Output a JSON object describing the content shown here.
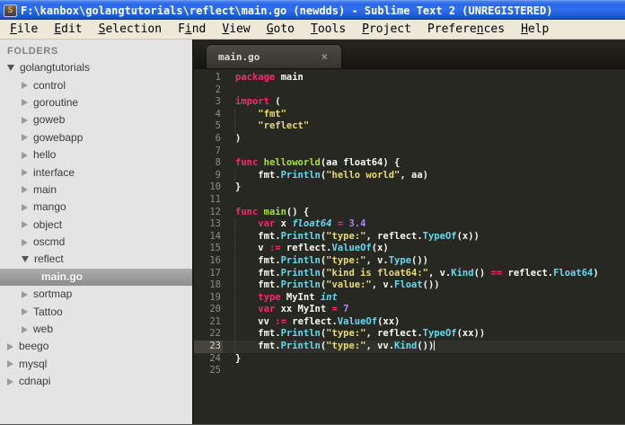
{
  "window": {
    "title": "F:\\kanbox\\golangtutorials\\reflect\\main.go (newdds) - Sublime Text 2 (UNREGISTERED)",
    "icon": "sublime-s-logo",
    "icon_glyph": "S"
  },
  "colors": {
    "titlebar_blue": "#2b67e8",
    "menubar_bg": "#ece9d8",
    "sidebar_bg": "#e4e4e4",
    "sidebar_selected": "#9a9a9a",
    "editor_bg": "#272822",
    "keyword_pink": "#f92672",
    "string_yellow": "#e6db74",
    "call_blue": "#66d9ef",
    "number_purple": "#ae81ff",
    "funcdef_green": "#a6e22e",
    "plain_text": "#f8f8f2",
    "gutter_text": "#8c8c84"
  },
  "menubar": {
    "items": [
      {
        "label": "File",
        "accel": 0
      },
      {
        "label": "Edit",
        "accel": 0
      },
      {
        "label": "Selection",
        "accel": 0
      },
      {
        "label": "Find",
        "accel": 1
      },
      {
        "label": "View",
        "accel": 0
      },
      {
        "label": "Goto",
        "accel": 0
      },
      {
        "label": "Tools",
        "accel": 0
      },
      {
        "label": "Project",
        "accel": 0
      },
      {
        "label": "Preferences",
        "accel": 7
      },
      {
        "label": "Help",
        "accel": 0
      }
    ]
  },
  "sidebar": {
    "header": "FOLDERS",
    "items": [
      {
        "label": "golangtutorials",
        "level": 1,
        "state": "expanded",
        "selected": false
      },
      {
        "label": "control",
        "level": 2,
        "state": "collapsed",
        "selected": false
      },
      {
        "label": "goroutine",
        "level": 2,
        "state": "collapsed",
        "selected": false
      },
      {
        "label": "goweb",
        "level": 2,
        "state": "collapsed",
        "selected": false
      },
      {
        "label": "gowebapp",
        "level": 2,
        "state": "collapsed",
        "selected": false
      },
      {
        "label": "hello",
        "level": 2,
        "state": "collapsed",
        "selected": false
      },
      {
        "label": "interface",
        "level": 2,
        "state": "collapsed",
        "selected": false
      },
      {
        "label": "main",
        "level": 2,
        "state": "collapsed",
        "selected": false
      },
      {
        "label": "mango",
        "level": 2,
        "state": "collapsed",
        "selected": false
      },
      {
        "label": "object",
        "level": 2,
        "state": "collapsed",
        "selected": false
      },
      {
        "label": "oscmd",
        "level": 2,
        "state": "collapsed",
        "selected": false
      },
      {
        "label": "reflect",
        "level": 2,
        "state": "expanded",
        "selected": false
      },
      {
        "label": "main.go",
        "level": 3,
        "state": "file",
        "selected": true
      },
      {
        "label": "sortmap",
        "level": 2,
        "state": "collapsed",
        "selected": false
      },
      {
        "label": "Tattoo",
        "level": 2,
        "state": "collapsed",
        "selected": false
      },
      {
        "label": "web",
        "level": 2,
        "state": "collapsed",
        "selected": false
      },
      {
        "label": "beego",
        "level": 1,
        "state": "collapsed",
        "selected": false
      },
      {
        "label": "mysql",
        "level": 1,
        "state": "collapsed",
        "selected": false
      },
      {
        "label": "cdnapi",
        "level": 1,
        "state": "collapsed",
        "selected": false
      }
    ]
  },
  "editor": {
    "tab": {
      "label": "main.go",
      "close": "×"
    },
    "lines": [
      {
        "n": 1,
        "seg": [
          [
            "k",
            "package"
          ],
          [
            "w",
            " main"
          ]
        ]
      },
      {
        "n": 2,
        "seg": []
      },
      {
        "n": 3,
        "seg": [
          [
            "k",
            "import"
          ],
          [
            "w",
            " ("
          ]
        ]
      },
      {
        "n": 4,
        "ind": true,
        "seg": [
          [
            "w",
            "    "
          ],
          [
            "s",
            "\"fmt\""
          ]
        ]
      },
      {
        "n": 5,
        "ind": true,
        "seg": [
          [
            "w",
            "    "
          ],
          [
            "s",
            "\"reflect\""
          ]
        ]
      },
      {
        "n": 6,
        "seg": [
          [
            "w",
            ")"
          ]
        ]
      },
      {
        "n": 7,
        "seg": []
      },
      {
        "n": 8,
        "seg": [
          [
            "k",
            "func"
          ],
          [
            "w",
            " "
          ],
          [
            "g",
            "helloworld"
          ],
          [
            "w",
            "(aa float64) {"
          ]
        ]
      },
      {
        "n": 9,
        "ind": true,
        "seg": [
          [
            "w",
            "    fmt."
          ],
          [
            "f",
            "Println"
          ],
          [
            "w",
            "("
          ],
          [
            "s",
            "\"hello world\""
          ],
          [
            "w",
            ", aa)"
          ]
        ]
      },
      {
        "n": 10,
        "seg": [
          [
            "w",
            "}"
          ]
        ]
      },
      {
        "n": 11,
        "seg": []
      },
      {
        "n": 12,
        "seg": [
          [
            "k",
            "func"
          ],
          [
            "w",
            " "
          ],
          [
            "g",
            "main"
          ],
          [
            "w",
            "() {"
          ]
        ]
      },
      {
        "n": 13,
        "ind": true,
        "seg": [
          [
            "w",
            "    "
          ],
          [
            "k",
            "var"
          ],
          [
            "w",
            " x "
          ],
          [
            "t",
            "float64"
          ],
          [
            "w",
            " "
          ],
          [
            "k",
            "="
          ],
          [
            "w",
            " "
          ],
          [
            "n2",
            "3.4"
          ]
        ]
      },
      {
        "n": 14,
        "ind": true,
        "seg": [
          [
            "w",
            "    fmt."
          ],
          [
            "f",
            "Println"
          ],
          [
            "w",
            "("
          ],
          [
            "s",
            "\"type:\""
          ],
          [
            "w",
            ", reflect."
          ],
          [
            "f",
            "TypeOf"
          ],
          [
            "w",
            "(x))"
          ]
        ]
      },
      {
        "n": 15,
        "ind": true,
        "seg": [
          [
            "w",
            "    v "
          ],
          [
            "k",
            ":="
          ],
          [
            "w",
            " reflect."
          ],
          [
            "f",
            "ValueOf"
          ],
          [
            "w",
            "(x)"
          ]
        ]
      },
      {
        "n": 16,
        "ind": true,
        "seg": [
          [
            "w",
            "    fmt."
          ],
          [
            "f",
            "Println"
          ],
          [
            "w",
            "("
          ],
          [
            "s",
            "\"type:\""
          ],
          [
            "w",
            ", v."
          ],
          [
            "f",
            "Type"
          ],
          [
            "w",
            "())"
          ]
        ]
      },
      {
        "n": 17,
        "ind": true,
        "seg": [
          [
            "w",
            "    fmt."
          ],
          [
            "f",
            "Println"
          ],
          [
            "w",
            "("
          ],
          [
            "s",
            "\"kind is float64:\""
          ],
          [
            "w",
            ", v."
          ],
          [
            "f",
            "Kind"
          ],
          [
            "w",
            "() "
          ],
          [
            "k",
            "=="
          ],
          [
            "w",
            " reflect."
          ],
          [
            "f",
            "Float64"
          ],
          [
            "w",
            ")"
          ]
        ]
      },
      {
        "n": 18,
        "ind": true,
        "seg": [
          [
            "w",
            "    fmt."
          ],
          [
            "f",
            "Println"
          ],
          [
            "w",
            "("
          ],
          [
            "s",
            "\"value:\""
          ],
          [
            "w",
            ", v."
          ],
          [
            "f",
            "Float"
          ],
          [
            "w",
            "())"
          ]
        ]
      },
      {
        "n": 19,
        "ind": true,
        "seg": [
          [
            "w",
            "    "
          ],
          [
            "k",
            "type"
          ],
          [
            "w",
            " MyInt "
          ],
          [
            "t",
            "int"
          ]
        ]
      },
      {
        "n": 20,
        "ind": true,
        "seg": [
          [
            "w",
            "    "
          ],
          [
            "k",
            "var"
          ],
          [
            "w",
            " xx MyInt "
          ],
          [
            "k",
            "="
          ],
          [
            "w",
            " "
          ],
          [
            "n2",
            "7"
          ]
        ]
      },
      {
        "n": 21,
        "ind": true,
        "seg": [
          [
            "w",
            "    vv "
          ],
          [
            "k",
            ":="
          ],
          [
            "w",
            " reflect."
          ],
          [
            "f",
            "ValueOf"
          ],
          [
            "w",
            "(xx)"
          ]
        ]
      },
      {
        "n": 22,
        "ind": true,
        "seg": [
          [
            "w",
            "    fmt."
          ],
          [
            "f",
            "Println"
          ],
          [
            "w",
            "("
          ],
          [
            "s",
            "\"type:\""
          ],
          [
            "w",
            ", reflect."
          ],
          [
            "f",
            "TypeOf"
          ],
          [
            "w",
            "(xx))"
          ]
        ]
      },
      {
        "n": 23,
        "ind": true,
        "cur": true,
        "caret": true,
        "seg": [
          [
            "w",
            "    fmt."
          ],
          [
            "f",
            "Println"
          ],
          [
            "w",
            "("
          ],
          [
            "s",
            "\"type:\""
          ],
          [
            "w",
            ", vv."
          ],
          [
            "f",
            "Kind"
          ],
          [
            "w",
            "())"
          ]
        ]
      },
      {
        "n": 24,
        "seg": [
          [
            "w",
            "}"
          ]
        ]
      },
      {
        "n": 25,
        "seg": []
      }
    ]
  }
}
